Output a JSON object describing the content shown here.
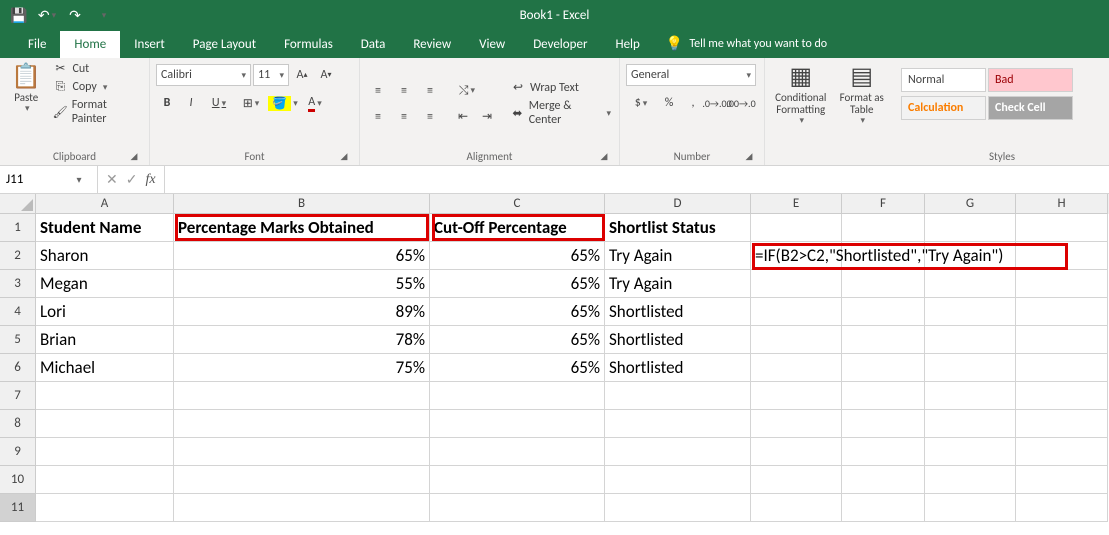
{
  "title": "Book1 - Excel",
  "tabs": [
    "File",
    "Home",
    "Insert",
    "Page Layout",
    "Formulas",
    "Data",
    "Review",
    "View",
    "Developer",
    "Help"
  ],
  "active_tab": "Home",
  "tellme": "Tell me what you want to do",
  "ribbon": {
    "clipboard": {
      "label": "Clipboard",
      "paste": "Paste",
      "cut": "Cut",
      "copy": "Copy",
      "fp": "Format Painter"
    },
    "font": {
      "label": "Font",
      "name": "Calibri",
      "size": "11"
    },
    "alignment": {
      "label": "Alignment",
      "wrap": "Wrap Text",
      "merge": "Merge & Center"
    },
    "number": {
      "label": "Number",
      "format": "General"
    },
    "styles": {
      "label": "Styles",
      "cond": "Conditional Formatting",
      "tbl": "Format as Table",
      "normal": "Normal",
      "bad": "Bad",
      "calc": "Calculation",
      "check": "Check Cell"
    }
  },
  "namebox": "J11",
  "formula": "",
  "columns": [
    "A",
    "B",
    "C",
    "D",
    "E",
    "F",
    "G",
    "H"
  ],
  "headers": {
    "a": "Student Name",
    "b": "Percentage Marks Obtained",
    "c": "Cut-Off Percentage",
    "d": "Shortlist Status"
  },
  "data": [
    {
      "name": "Sharon",
      "pct": "65%",
      "cut": "65%",
      "status": "Try Again"
    },
    {
      "name": "Megan",
      "pct": "55%",
      "cut": "65%",
      "status": "Try Again"
    },
    {
      "name": "Lori",
      "pct": "89%",
      "cut": "65%",
      "status": "Shortlisted"
    },
    {
      "name": "Brian",
      "pct": "78%",
      "cut": "65%",
      "status": "Shortlisted"
    },
    {
      "name": "Michael",
      "pct": "75%",
      "cut": "65%",
      "status": "Shortlisted"
    }
  ],
  "formula_annotation": "=IF(B2>C2,\"Shortlisted\",\"Try Again\")"
}
